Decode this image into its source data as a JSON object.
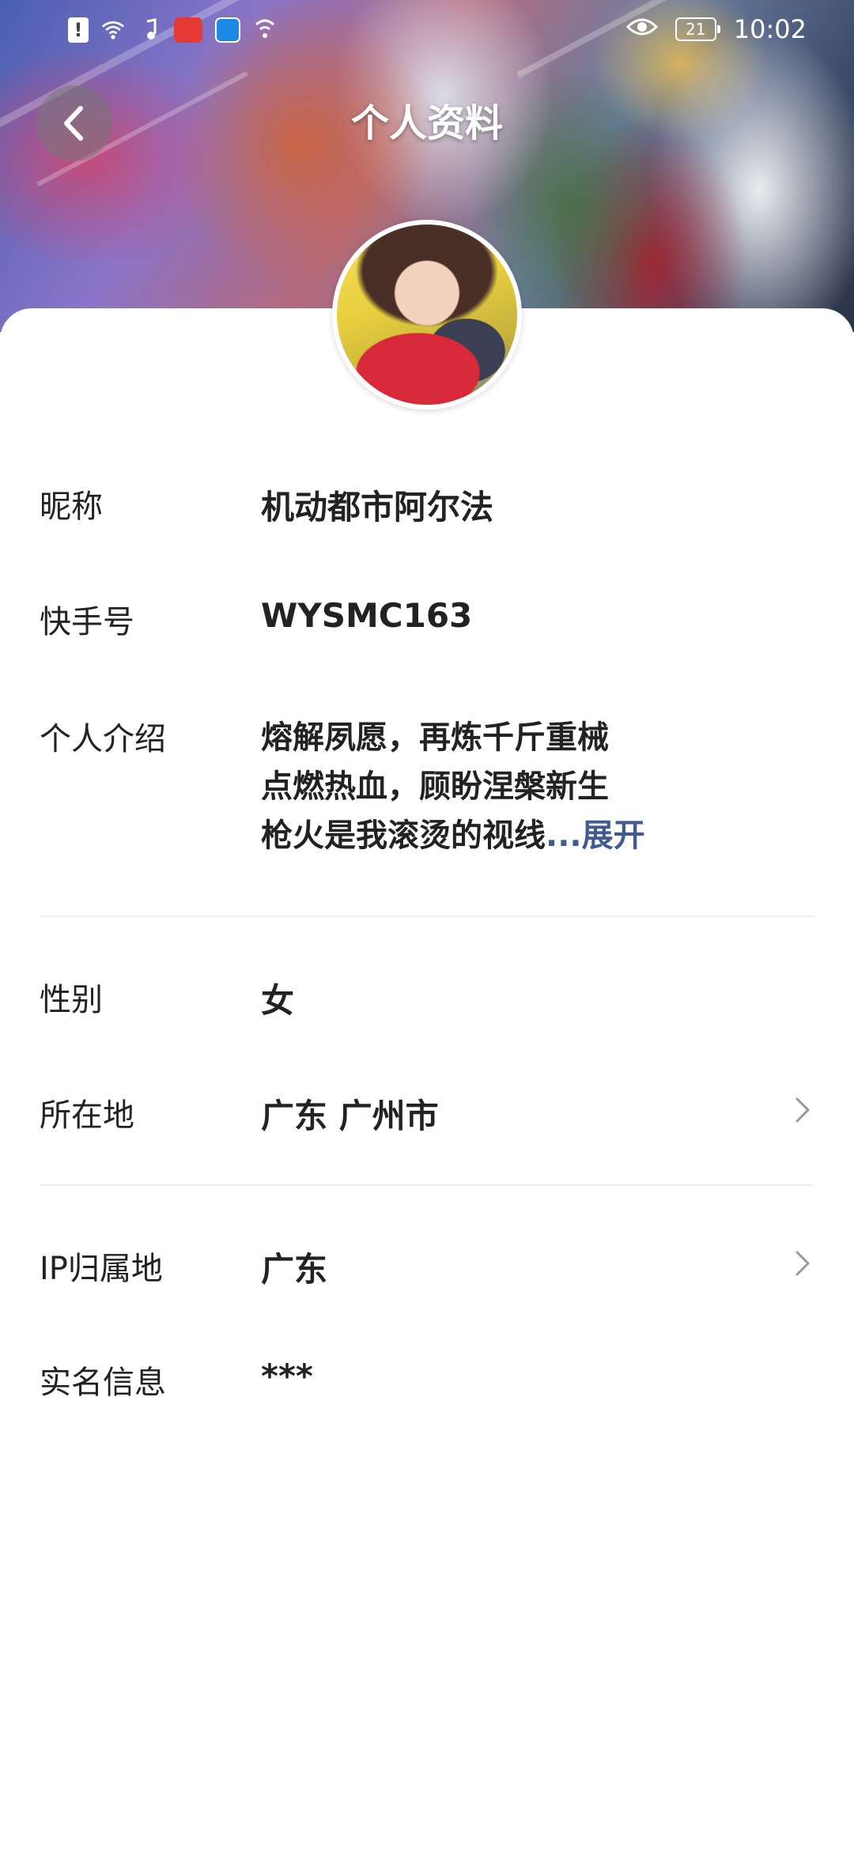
{
  "status_bar": {
    "time": "10:02",
    "battery": "21",
    "left_icons": [
      "alert-icon",
      "wifi-icon",
      "music-icon",
      "huawei-app-icon",
      "browser-icon",
      "signal-icon"
    ],
    "right_icons": [
      "eye-icon",
      "battery-icon"
    ]
  },
  "header": {
    "title": "个人资料",
    "back_icon": "chevron-left-icon"
  },
  "profile": {
    "nickname_label": "昵称",
    "nickname_value": "机动都市阿尔法",
    "id_label": "快手号",
    "id_value": "WYSMC163",
    "bio_label": "个人介绍",
    "bio_lines": [
      "熔解夙愿，再炼千斤重械",
      "点燃热血，顾盼涅槃新生",
      "枪火是我滚烫的视线"
    ],
    "bio_ellipsis": "...",
    "bio_expand": "展开",
    "gender_label": "性别",
    "gender_value": "女",
    "location_label": "所在地",
    "location_value": "广东 广州市",
    "ip_label": "IP归属地",
    "ip_value": "广东",
    "realname_label": "实名信息",
    "realname_value": "***"
  },
  "colors": {
    "link": "#3f5b8f",
    "text": "#222222",
    "divider": "#eeeeee"
  }
}
